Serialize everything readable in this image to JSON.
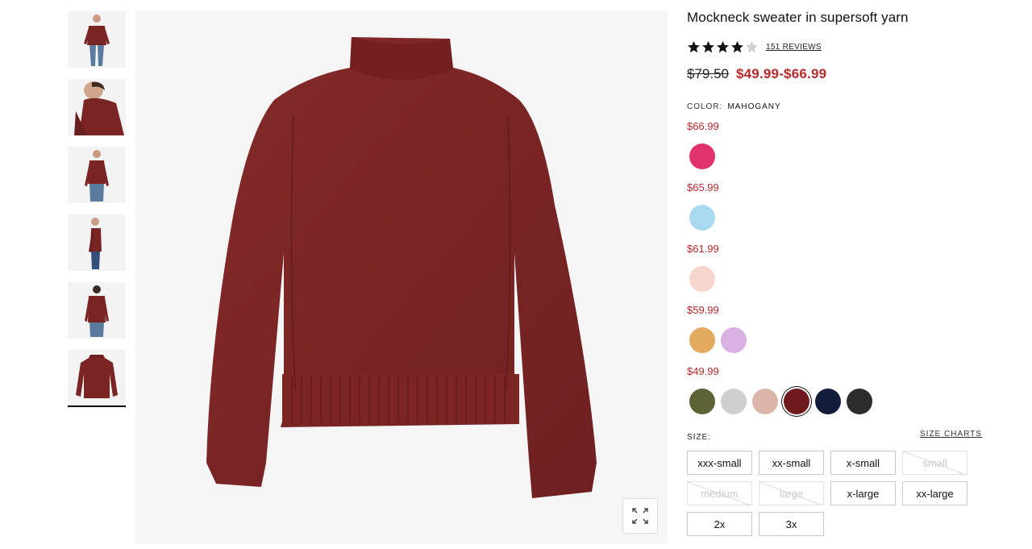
{
  "product": {
    "title": "Mockneck sweater in supersoft yarn",
    "rating": 4,
    "rating_max": 5,
    "reviews_text": "151 REVIEWS",
    "original_price": "$79.50",
    "sale_range": "$49.99-$66.99"
  },
  "color": {
    "label": "COLOR:",
    "selected": "MAHOGANY",
    "groups": [
      {
        "price": "$66.99",
        "swatches": [
          {
            "name": "pink",
            "hex": "#e0336b"
          }
        ]
      },
      {
        "price": "$65.99",
        "swatches": [
          {
            "name": "light-blue",
            "hex": "#a9d9ef"
          }
        ]
      },
      {
        "price": "$61.99",
        "swatches": [
          {
            "name": "blush",
            "hex": "#f6d6cc"
          }
        ]
      },
      {
        "price": "$59.99",
        "swatches": [
          {
            "name": "mustard",
            "hex": "#e3a95e"
          },
          {
            "name": "lilac",
            "hex": "#d9b2e3"
          }
        ]
      },
      {
        "price": "$49.99",
        "swatches": [
          {
            "name": "olive",
            "hex": "#5d6335"
          },
          {
            "name": "light-grey",
            "hex": "#cfcfcf"
          },
          {
            "name": "beige",
            "hex": "#dbb6a8"
          },
          {
            "name": "mahogany",
            "hex": "#6e1a1c",
            "selected": true
          },
          {
            "name": "navy",
            "hex": "#131d3a"
          },
          {
            "name": "charcoal",
            "hex": "#2c2c2c"
          }
        ]
      }
    ]
  },
  "size": {
    "label": "SIZE:",
    "charts_link": "SIZE CHARTS",
    "options": [
      {
        "label": "xxx-small",
        "available": true
      },
      {
        "label": "xx-small",
        "available": true
      },
      {
        "label": "x-small",
        "available": true
      },
      {
        "label": "small",
        "available": false
      },
      {
        "label": "medium",
        "available": false
      },
      {
        "label": "large",
        "available": false
      },
      {
        "label": "x-large",
        "available": true
      },
      {
        "label": "xx-large",
        "available": true
      },
      {
        "label": "2x",
        "available": true
      },
      {
        "label": "3x",
        "available": true
      }
    ]
  },
  "gallery": {
    "thumbnails": [
      {
        "name": "model-front-full"
      },
      {
        "name": "model-closeup-side"
      },
      {
        "name": "model-front-tucked"
      },
      {
        "name": "model-profile"
      },
      {
        "name": "model-back"
      },
      {
        "name": "product-flat",
        "selected": true
      }
    ],
    "main_color": "#7a2424",
    "zoom_icon": "expand-icon"
  }
}
